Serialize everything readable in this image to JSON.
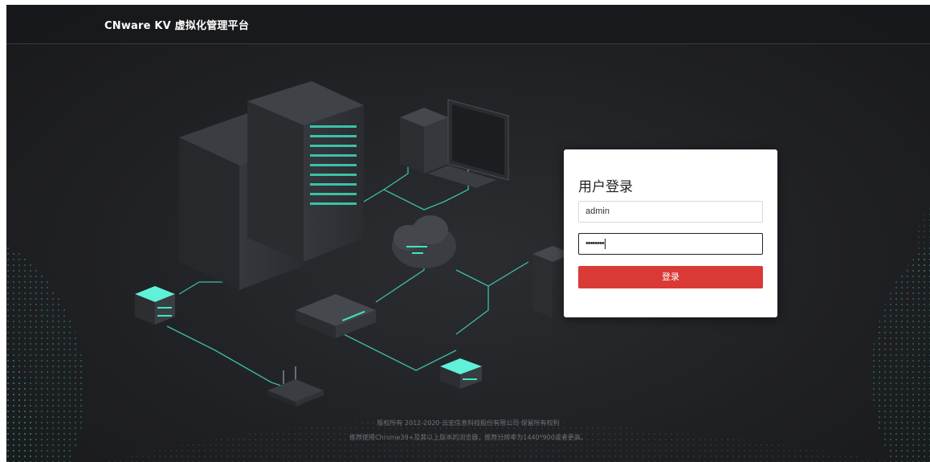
{
  "header": {
    "title": "CNware KV 虚拟化管理平台"
  },
  "login": {
    "title": "用户登录",
    "username_value": "admin",
    "password_value": "••••••••",
    "submit_label": "登录"
  },
  "footer": {
    "copyright": "版权所有 2012-2020 云宏信息科技股份有限公司 保留所有权利",
    "browser_note": "推荐使用Chrome39+及其以上版本的浏览器，推荐分辨率为1440*900或者更高。"
  },
  "colors": {
    "background": "#1f2023",
    "accent_teal": "#3ee6c4",
    "login_button": "#d93a36",
    "panel": "#ffffff"
  },
  "icons": [
    "server-rack-icon",
    "desktop-computer-icon",
    "cloud-icon",
    "router-icon",
    "network-switch-icon",
    "small-server-icon"
  ]
}
